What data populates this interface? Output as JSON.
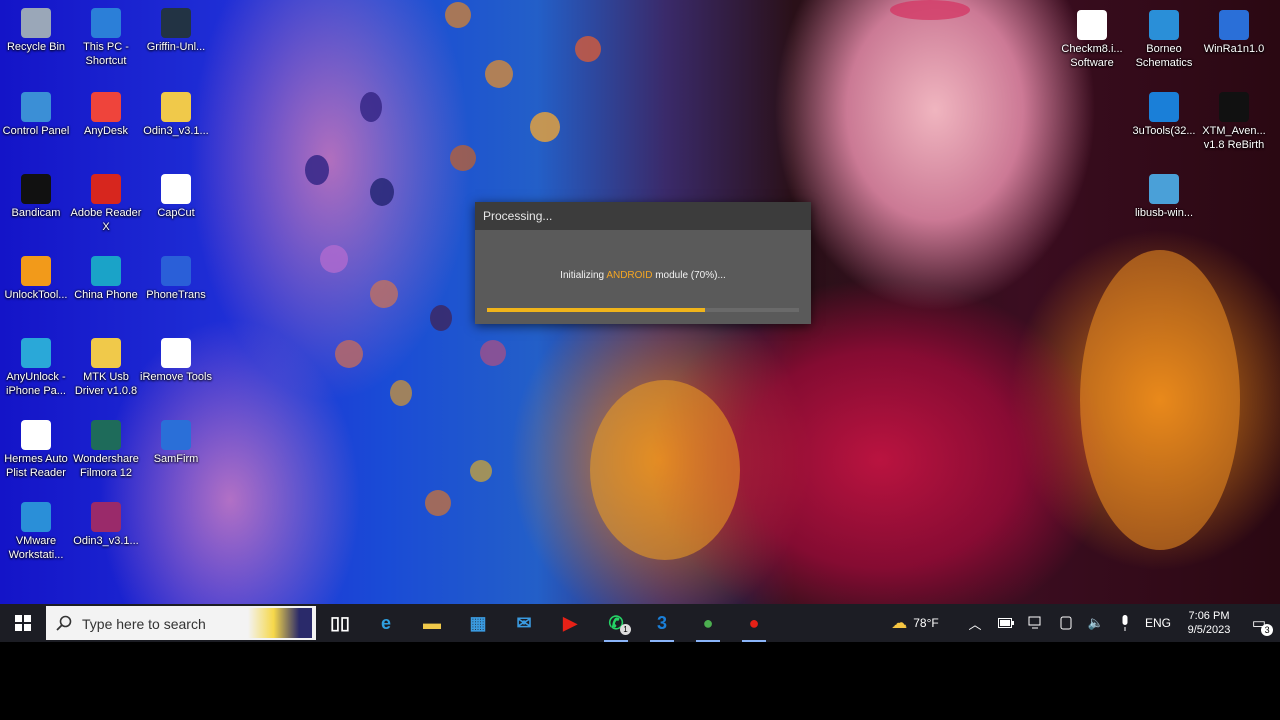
{
  "desktop": {
    "icons": [
      {
        "name": "recycle-bin-icon",
        "label": "Recycle Bin",
        "icon": "bin",
        "color": "#9aa7b8"
      },
      {
        "name": "this-pc-icon",
        "label": "This PC - Shortcut",
        "icon": "pc",
        "color": "#2b7fd8"
      },
      {
        "name": "griffin-unlocker-icon",
        "label": "Griffin-Unl...",
        "icon": "griffin",
        "color": "#223344"
      },
      {
        "name": "control-panel-icon",
        "label": "Control Panel",
        "icon": "panel",
        "color": "#3b8fd6"
      },
      {
        "name": "anydesk-icon",
        "label": "AnyDesk",
        "icon": "anydesk",
        "color": "#ef443b"
      },
      {
        "name": "odin-folder-icon",
        "label": "Odin3_v3.1...",
        "icon": "folder",
        "color": "#f0c94a"
      },
      {
        "name": "bandicam-icon",
        "label": "Bandicam",
        "icon": "bandicam",
        "color": "#111111"
      },
      {
        "name": "adobe-reader-icon",
        "label": "Adobe Reader X",
        "icon": "pdf",
        "color": "#d7261e"
      },
      {
        "name": "capcut-icon",
        "label": "CapCut",
        "icon": "capcut",
        "color": "#ffffff"
      },
      {
        "name": "unlocktool-icon",
        "label": "UnlockTool...",
        "icon": "unlock",
        "color": "#f29a1a"
      },
      {
        "name": "china-phone-icon",
        "label": "China Phone",
        "icon": "edge",
        "color": "#1aa3c8"
      },
      {
        "name": "phonetrans-icon",
        "label": "PhoneTrans",
        "icon": "phonetrans",
        "color": "#2a5fd8"
      },
      {
        "name": "anyunlock-icon",
        "label": "AnyUnlock - iPhone Pa...",
        "icon": "anyunlock",
        "color": "#2aa8d8"
      },
      {
        "name": "mtk-usb-driver-icon",
        "label": "MTK Usb Driver v1.0.8",
        "icon": "folder",
        "color": "#f0c94a"
      },
      {
        "name": "iremove-tools-icon",
        "label": "iRemove Tools",
        "icon": "iremove",
        "color": "#ffffff"
      },
      {
        "name": "hermes-auto-icon",
        "label": "Hermes Auto Plist Reader",
        "icon": "hermes",
        "color": "#ffffff"
      },
      {
        "name": "wondershare-filmora-icon",
        "label": "Wondershare Filmora 12",
        "icon": "filmora",
        "color": "#1e6b5a"
      },
      {
        "name": "samfirm-icon",
        "label": "SamFirm",
        "icon": "samfirm",
        "color": "#2a6fd8"
      },
      {
        "name": "vmware-icon",
        "label": "VMware Workstati...",
        "icon": "vmware",
        "color": "#2a8fd8"
      },
      {
        "name": "odin-archive-icon",
        "label": "Odin3_v3.1...",
        "icon": "rar",
        "color": "#9a2a6a"
      }
    ],
    "right_icons": [
      {
        "name": "checkm8-icon",
        "label": "Checkm8.i... Software",
        "icon": "checkm8",
        "color": "#ffffff"
      },
      {
        "name": "borneo-schematics-icon",
        "label": "Borneo Schematics",
        "icon": "borneo",
        "color": "#2a8fd8"
      },
      {
        "name": "winra1n-icon",
        "label": "WinRa1n1.0",
        "icon": "winra1n",
        "color": "#2a6fd8"
      },
      {
        "name": "3utools-icon",
        "label": "3uTools(32...",
        "icon": "3u",
        "color": "#1a7fd8"
      },
      {
        "name": "xtm-avengers-icon",
        "label": "XTM_Aven... v1.8 ReBirth",
        "icon": "xtm",
        "color": "#111111"
      },
      {
        "name": "libusb-win-icon",
        "label": "libusb-win...",
        "icon": "libusb",
        "color": "#4aa0d8"
      }
    ]
  },
  "dialog": {
    "title": "Processing...",
    "message_prefix": "Initializing ",
    "message_highlight": "ANDROID",
    "message_suffix": " module (70%)...",
    "progress": 0.7,
    "accent": "#f0b41a"
  },
  "taskbar": {
    "search_placeholder": "Type here to search",
    "pinned": [
      {
        "name": "task-view-icon",
        "glyph": "▯▯",
        "color": "#ffffff"
      },
      {
        "name": "edge-icon",
        "glyph": "e",
        "color": "#2fa0e0"
      },
      {
        "name": "file-explorer-icon",
        "glyph": "▬",
        "color": "#f0c94a"
      },
      {
        "name": "microsoft-store-icon",
        "glyph": "▦",
        "color": "#3a9ae0"
      },
      {
        "name": "mail-icon",
        "glyph": "✉",
        "color": "#3a9ae0"
      },
      {
        "name": "youtube-icon",
        "glyph": "▶",
        "color": "#e62117"
      },
      {
        "name": "whatsapp-icon",
        "glyph": "✆",
        "color": "#25d366"
      },
      {
        "name": "3utools-taskbar-icon",
        "glyph": "3",
        "color": "#1a7fd8"
      },
      {
        "name": "chrome-icon",
        "glyph": "●",
        "color": "#4caf50"
      },
      {
        "name": "record-icon",
        "glyph": "●",
        "color": "#e62117"
      }
    ],
    "weather": "78°F",
    "language": "ENG",
    "time": "7:06 PM",
    "date": "9/5/2023",
    "notification_count": "3",
    "whatsapp_badge": "1"
  }
}
